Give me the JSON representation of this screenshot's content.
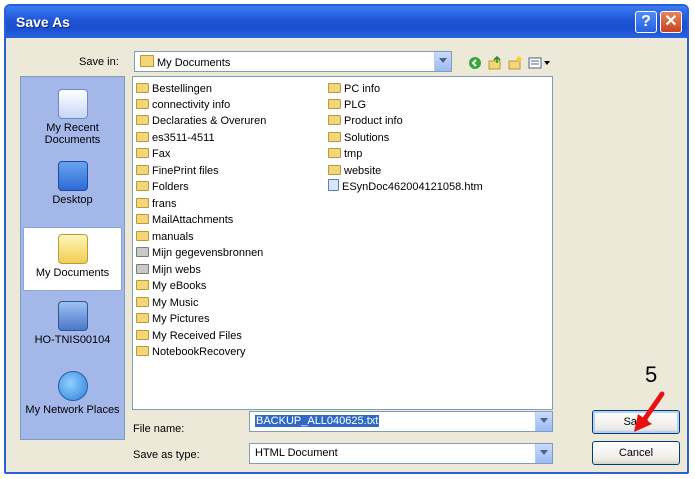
{
  "window": {
    "title": "Save As"
  },
  "save_in": {
    "label": "Save in:",
    "value": "My Documents"
  },
  "places": [
    {
      "label": "My Recent Documents",
      "icon": "recent-documents-icon"
    },
    {
      "label": "Desktop",
      "icon": "desktop-icon"
    },
    {
      "label": "My Documents",
      "icon": "my-documents-icon"
    },
    {
      "label": "HO-TNIS00104",
      "icon": "computer-icon"
    },
    {
      "label": "My Network Places",
      "icon": "network-icon"
    }
  ],
  "files_col1": [
    "Bestellingen",
    "connectivity info",
    "Declaraties & Overuren",
    "es3511-4511",
    "Fax",
    "FinePrint files",
    "Folders",
    "frans",
    "MailAttachments",
    "manuals",
    "Mijn gegevensbronnen",
    "Mijn webs",
    "My eBooks",
    "My Music",
    "My Pictures",
    "My Received Files",
    "NotebookRecovery"
  ],
  "files_col2": [
    "PC info",
    "PLG",
    "Product info",
    "Solutions",
    "tmp",
    "website",
    "ESynDoc462004121058.htm"
  ],
  "file_name": {
    "label": "File name:",
    "value": "BACKUP_ALL040625.txt"
  },
  "save_as_type": {
    "label": "Save as type:",
    "value": "HTML Document"
  },
  "buttons": {
    "save": "Save",
    "cancel": "Cancel"
  },
  "annotation": {
    "step_number": "5",
    "arrow_color": "#e81010"
  }
}
